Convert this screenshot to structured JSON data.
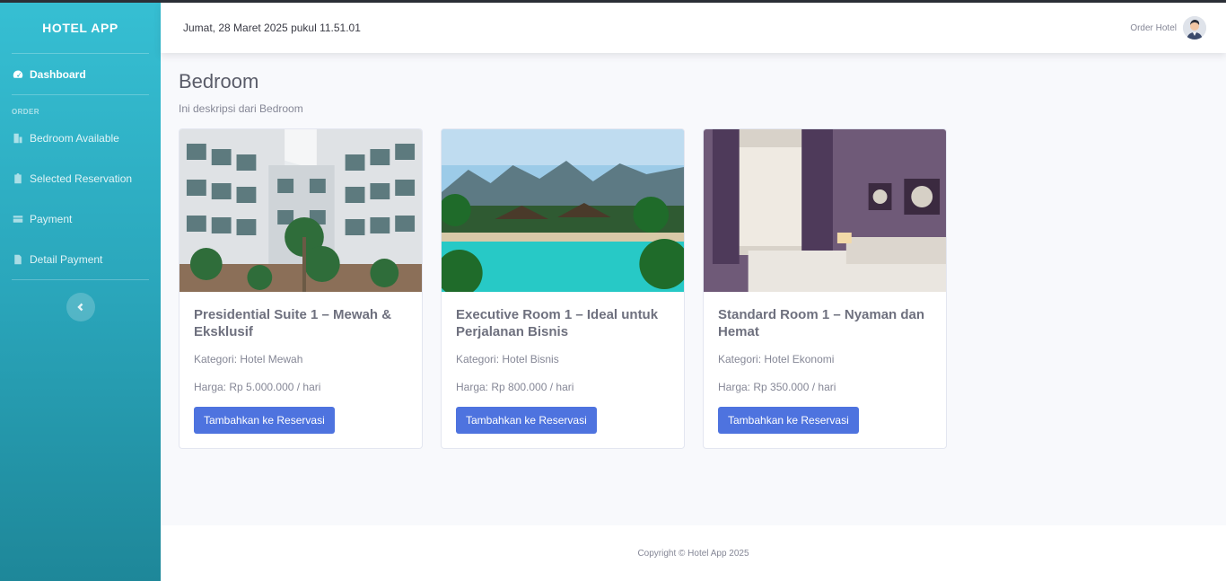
{
  "sidebar": {
    "brand": "HOTEL APP",
    "dashboard_label": "Dashboard",
    "heading": "ORDER",
    "items": [
      {
        "label": "Bedroom Available",
        "icon": "building-icon"
      },
      {
        "label": "Selected Reservation",
        "icon": "clipboard-check-icon"
      },
      {
        "label": "Payment",
        "icon": "credit-card-icon"
      },
      {
        "label": "Detail Payment",
        "icon": "file-invoice-icon"
      }
    ],
    "toggle_icon": "chevron-left-icon"
  },
  "topbar": {
    "datetime": "Jumat, 28 Maret 2025 pukul 11.51.01",
    "user_name": "Order Hotel"
  },
  "page": {
    "title": "Bedroom",
    "description": "Ini deskripsi dari Bedroom"
  },
  "cards": [
    {
      "title": "Presidential Suite 1 – Mewah & Eksklusif",
      "category": "Kategori: Hotel Mewah",
      "price": "Harga: Rp 5.000.000 / hari",
      "button": "Tambahkan ke Reservasi"
    },
    {
      "title": "Executive Room 1 – Ideal untuk Perjalanan Bisnis",
      "category": "Kategori: Hotel Bisnis",
      "price": "Harga: Rp 800.000 / hari",
      "button": "Tambahkan ke Reservasi"
    },
    {
      "title": "Standard Room 1 – Nyaman dan Hemat",
      "category": "Kategori: Hotel Ekonomi",
      "price": "Harga: Rp 350.000 / hari",
      "button": "Tambahkan ke Reservasi"
    }
  ],
  "footer": {
    "copyright": "Copyright © Hotel App 2025"
  },
  "colors": {
    "primary": "#4e73df",
    "sidebar_start": "#36bfd3",
    "sidebar_end": "#1e8799"
  }
}
